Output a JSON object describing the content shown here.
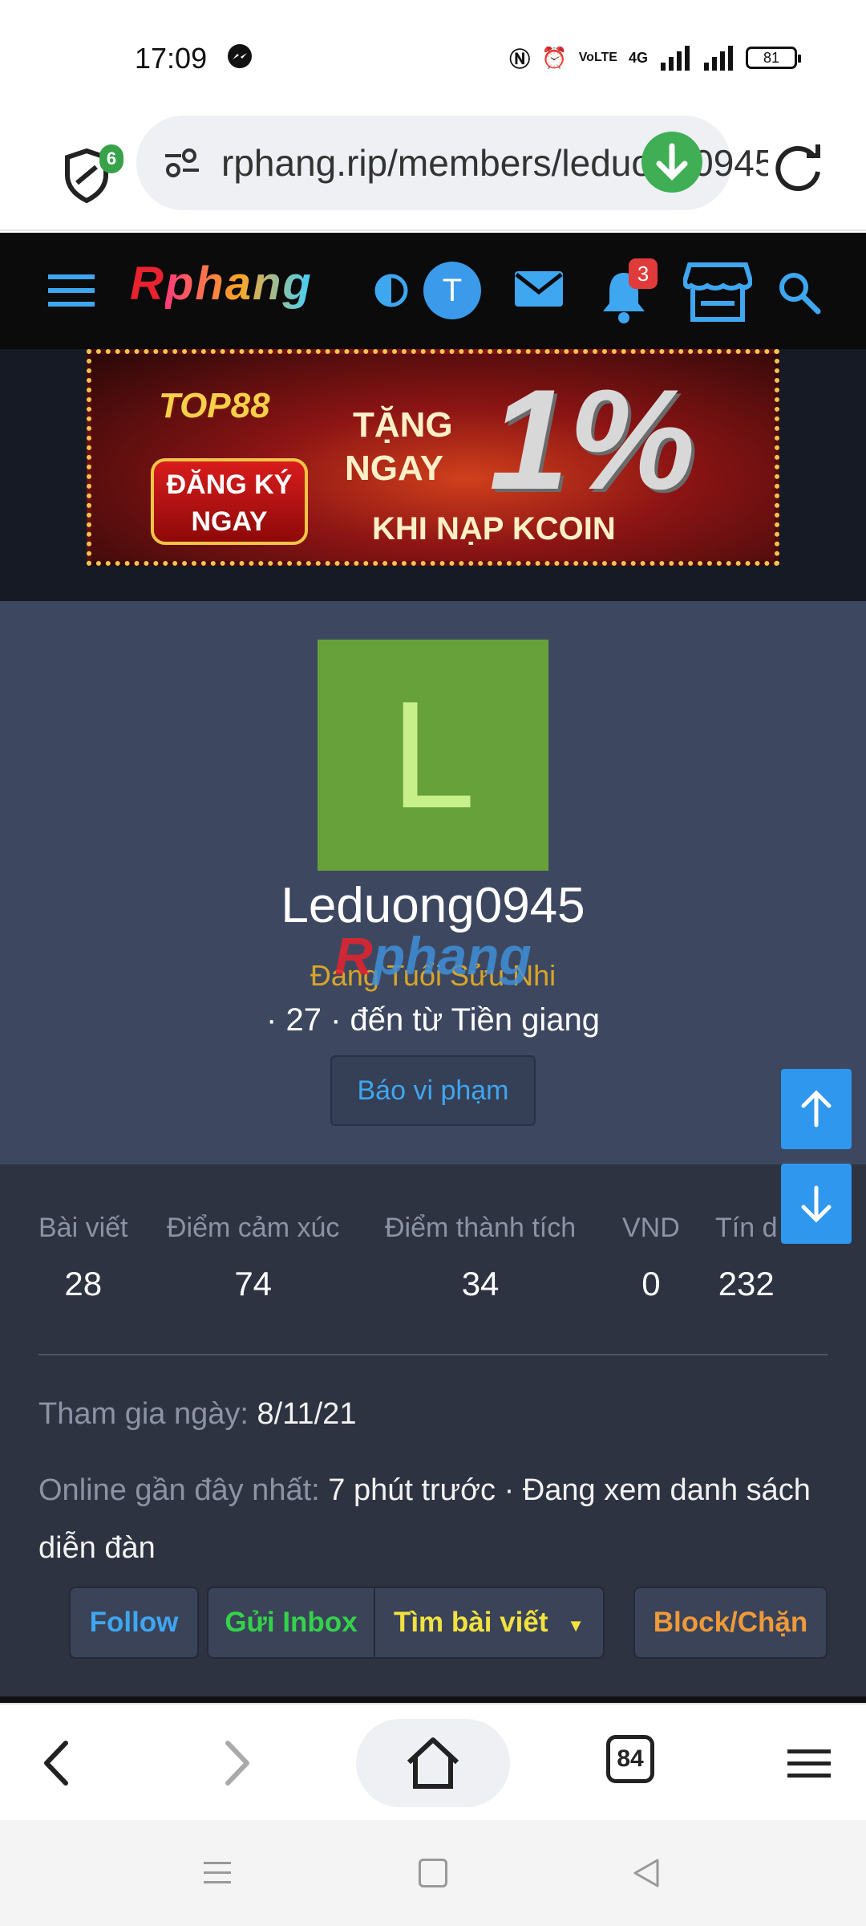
{
  "status_bar": {
    "time": "17:09",
    "battery": "81",
    "network_label": "4G"
  },
  "browser": {
    "url": "rphang.rip/members/leduong0945",
    "shield_badge_count": "6",
    "tab_count": "84"
  },
  "site_header": {
    "logo_first": "R",
    "logo_rest": "phang",
    "user_initial": "T",
    "notification_count": "3"
  },
  "ad": {
    "brand": "TOP88",
    "register_line1": "ĐĂNG KÝ",
    "register_line2": "NGAY",
    "line1": "TẶNG",
    "line2": "NGAY",
    "big": "1%",
    "line3": "KHI NẠP KCOIN"
  },
  "profile": {
    "avatar_letter": "L",
    "username": "Leduong0945",
    "watermark_first": "R",
    "watermark_rest": "phang",
    "title": "Đang Tuổi Sửu Nhi",
    "meta": "· 27 · đến từ Tiền giang",
    "report_label": "Báo vi phạm"
  },
  "stats": [
    {
      "label": "Bài viết",
      "value": "28"
    },
    {
      "label": "Điểm cảm xúc",
      "value": "74"
    },
    {
      "label": "Điểm thành tích",
      "value": "34"
    },
    {
      "label": "VND",
      "value": "0"
    },
    {
      "label": "Tín d",
      "value": "232"
    }
  ],
  "info": {
    "joined_label": "Tham gia ngày:",
    "joined_value": "8/11/21",
    "online_label": "Online gần đây nhất:",
    "online_value": "7 phút trước · Đang xem danh sách diễn đàn"
  },
  "actions": {
    "follow": "Follow",
    "inbox": "Gửi Inbox",
    "find_posts": "Tìm bài viết",
    "block": "Block/Chặn"
  },
  "colors": {
    "accent_blue": "#2f97ee",
    "profile_bg": "#3d4860",
    "body_bg": "#2d3341",
    "avatar_green": "#67a13a"
  }
}
